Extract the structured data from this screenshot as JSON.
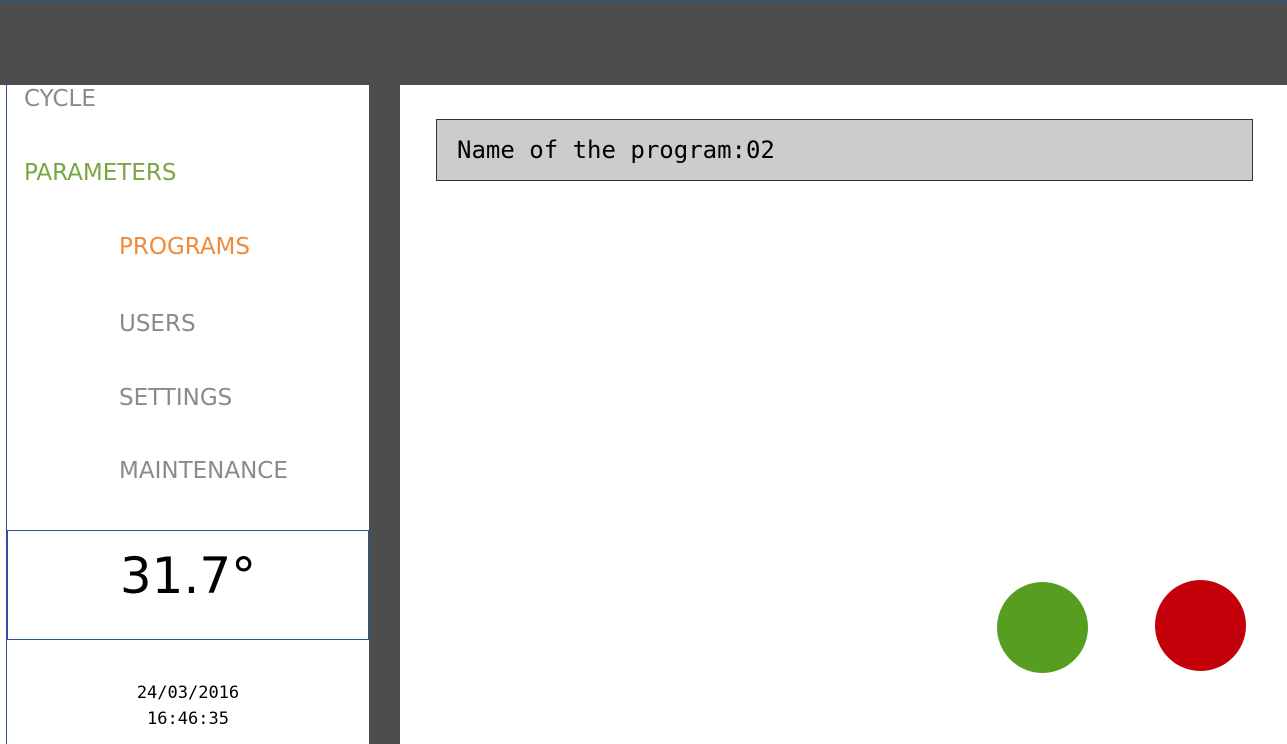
{
  "colors": {
    "topbar": "#4d4d4d",
    "nav_inactive": "#8a8a8a",
    "nav_section_active": "#7aa641",
    "nav_item_active": "#f08a3a",
    "confirm_button": "#579e20",
    "cancel_button": "#c4000a"
  },
  "sidebar": {
    "items": [
      {
        "label": "CYCLE"
      },
      {
        "label": "PARAMETERS"
      },
      {
        "label": "PROGRAMS"
      },
      {
        "label": "USERS"
      },
      {
        "label": "SETTINGS"
      },
      {
        "label": "MAINTENANCE"
      }
    ],
    "temperature": {
      "value": "31.7",
      "unit": "°"
    },
    "date": "24/03/2016",
    "time": "16:46:35"
  },
  "main": {
    "program_name_label": "Name of the program:02"
  },
  "buttons": {
    "confirm_icon": "green-circle",
    "cancel_icon": "red-circle"
  }
}
